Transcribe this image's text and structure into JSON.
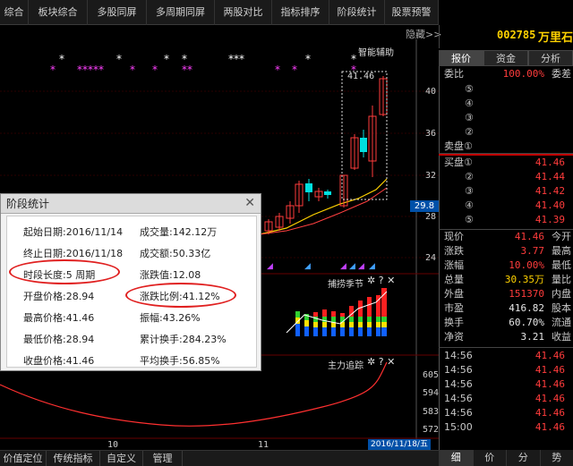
{
  "topnav": {
    "tabs": [
      "综合",
      "板块综合",
      "多股同屏",
      "多周期同屏",
      "两股对比",
      "指标排序",
      "阶段统计",
      "股票预警"
    ]
  },
  "chart": {
    "hide_label": "隐藏>>",
    "assist_label": "智能辅助",
    "high_label": "41.46",
    "current_price_tag": "29.8",
    "y_axis": [
      "40",
      "36",
      "32",
      "28",
      "24"
    ],
    "date_ticks": [
      "10",
      "11"
    ],
    "date_tag": "2016/11/18/五",
    "sub1_title": "捕捞季节",
    "sub2_title": "主力追踪",
    "sub2_axis": [
      "605",
      "594",
      "583",
      "572"
    ],
    "toolbar_icons": [
      "gear-icon",
      "help-icon",
      "close-icon"
    ]
  },
  "stats_dialog": {
    "title": "阶段统计",
    "left": [
      "起始日期:2016/11/14",
      "终止日期:2016/11/18",
      "时段长度:5  周期",
      "开盘价格:28.94",
      "最高价格:41.46",
      "最低价格:28.94",
      "收盘价格:41.46"
    ],
    "right": [
      "成交量:142.12万",
      "成交额:50.33亿",
      "涨跌值:12.08",
      "涨跌比例:41.12%",
      "振幅:43.26%",
      "累计换手:284.23%",
      "平均换手:56.85%"
    ]
  },
  "stock": {
    "code": "002785",
    "name": "万里石",
    "tabs": [
      "报价",
      "资金",
      "分析"
    ],
    "weibi_label": "委比",
    "weibi_value": "100.00%",
    "weicha_label": "委差",
    "sell_levels": [
      "⑤",
      "④",
      "③",
      "②"
    ],
    "sell_label": "卖盘①",
    "buy_label": "买盘①",
    "buy_levels": [
      {
        "idx": "",
        "price": "41.46"
      },
      {
        "idx": "②",
        "price": "41.44"
      },
      {
        "idx": "③",
        "price": "41.42"
      },
      {
        "idx": "④",
        "price": "41.40"
      },
      {
        "idx": "⑤",
        "price": "41.39"
      }
    ],
    "quotes": [
      {
        "label": "现价",
        "value": "41.46",
        "cls": "red",
        "label2": "今开"
      },
      {
        "label": "涨跌",
        "value": "3.77",
        "cls": "red",
        "label2": "最高"
      },
      {
        "label": "涨幅",
        "value": "10.00%",
        "cls": "red",
        "label2": "最低"
      },
      {
        "label": "总量",
        "value": "30.35万",
        "cls": "yellow",
        "label2": "量比"
      },
      {
        "label": "外盘",
        "value": "151370",
        "cls": "red",
        "label2": "内盘"
      },
      {
        "label": "市盈",
        "value": "416.82",
        "cls": "white",
        "label2": "股本"
      },
      {
        "label": "换手",
        "value": "60.70%",
        "cls": "white",
        "label2": "流通"
      },
      {
        "label": "净资",
        "value": "3.21",
        "cls": "white",
        "label2": "收益"
      }
    ],
    "ticks": [
      {
        "time": "14:56",
        "price": "41.46"
      },
      {
        "time": "14:56",
        "price": "41.46"
      },
      {
        "time": "14:56",
        "price": "41.46"
      },
      {
        "time": "14:56",
        "price": "41.46"
      },
      {
        "time": "14:56",
        "price": "41.46"
      },
      {
        "time": "15:00",
        "price": "41.46"
      }
    ]
  },
  "bottomtabs": [
    "价值定位",
    "传统指标",
    "自定义",
    "管理"
  ],
  "rbottomtabs": [
    "细",
    "价",
    "分",
    "势"
  ],
  "colors": {
    "up": "#ff3c3c",
    "down": "#00dd00",
    "accent": "#ffd200"
  }
}
